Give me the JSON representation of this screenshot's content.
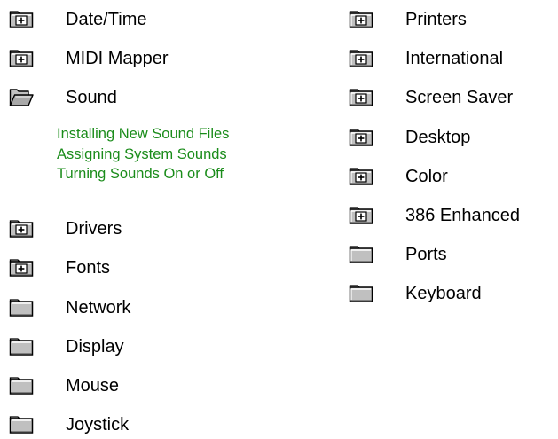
{
  "colors": {
    "topic_text": "#000000",
    "subtopic_text": "#1a8c1a",
    "folder_fill": "#c0c0c0",
    "folder_outline": "#000000"
  },
  "left_column": [
    {
      "label": "Date/Time",
      "icon": "folder-plus-icon"
    },
    {
      "label": "MIDI Mapper",
      "icon": "folder-plus-icon"
    },
    {
      "label": "Sound",
      "icon": "folder-open-icon",
      "expanded": true
    },
    {
      "label": "Drivers",
      "icon": "folder-plus-icon"
    },
    {
      "label": "Fonts",
      "icon": "folder-plus-icon"
    },
    {
      "label": "Network",
      "icon": "folder-icon"
    },
    {
      "label": "Display",
      "icon": "folder-icon"
    },
    {
      "label": "Mouse",
      "icon": "folder-icon"
    },
    {
      "label": "Joystick",
      "icon": "folder-icon"
    }
  ],
  "sound_subtopics": [
    "Installing New Sound Files",
    "Assigning System Sounds",
    "Turning Sounds On or Off"
  ],
  "right_column": [
    {
      "label": "Printers",
      "icon": "folder-plus-icon"
    },
    {
      "label": "International",
      "icon": "folder-plus-icon"
    },
    {
      "label": "Screen Saver",
      "icon": "folder-plus-icon"
    },
    {
      "label": "Desktop",
      "icon": "folder-plus-icon"
    },
    {
      "label": "Color",
      "icon": "folder-plus-icon"
    },
    {
      "label": "386 Enhanced",
      "icon": "folder-plus-icon"
    },
    {
      "label": "Ports",
      "icon": "folder-icon"
    },
    {
      "label": "Keyboard",
      "icon": "folder-icon"
    }
  ]
}
